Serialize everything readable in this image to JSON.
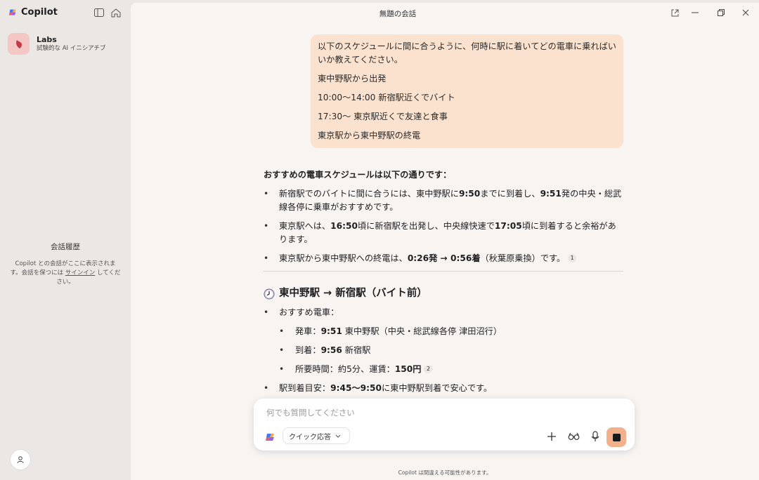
{
  "app": {
    "name": "Copilot"
  },
  "window": {
    "title": "無題の会話"
  },
  "sidebar": {
    "labs": {
      "title": "Labs",
      "subtitle": "試験的な AI イニシアチブ"
    },
    "history": {
      "title": "会話履歴",
      "text_before": "Copilot との会話がここに表示されます。会話を保つには ",
      "link": "サインイン",
      "text_after": " してください。"
    }
  },
  "user_message": {
    "paragraphs": [
      "以下のスケジュールに間に合うように、何時に駅に着いてどの電車に乗ればいいか教えてください。",
      "東中野駅から出発",
      "10:00〜14:00 新宿駅近くでバイト",
      "17:30〜 東京駅近くで友達と食事",
      "東京駅から東中野駅の終電"
    ]
  },
  "answer": {
    "intro": "おすすめの電車スケジュールは以下の通りです：",
    "summary": [
      {
        "parts": [
          {
            "t": "新宿駅でのバイトに間に合うには、東中野駅に",
            "b": false
          },
          {
            "t": "9:50",
            "b": true
          },
          {
            "t": "までに到着し、",
            "b": false
          },
          {
            "t": "9:51",
            "b": true
          },
          {
            "t": "発の中央・総武線各停に乗車がおすすめです。",
            "b": false
          }
        ]
      },
      {
        "parts": [
          {
            "t": "東京駅へは、",
            "b": false
          },
          {
            "t": "16:50",
            "b": true
          },
          {
            "t": "頃に新宿駅を出発し、中央線快速で",
            "b": false
          },
          {
            "t": "17:05",
            "b": true
          },
          {
            "t": "頃に到着すると余裕があります。",
            "b": false
          }
        ]
      },
      {
        "parts": [
          {
            "t": "東京駅から東中野駅への終電は、",
            "b": false
          },
          {
            "t": "0:26発 → 0:56着",
            "b": true
          },
          {
            "t": "（秋葉原乗換）です。",
            "b": false
          }
        ],
        "cite": "1"
      }
    ],
    "section": {
      "heading": "東中野駅 → 新宿駅（バイト前）",
      "recommend_label": "おすすめ電車：",
      "details": [
        {
          "parts": [
            {
              "t": "発車：",
              "b": false
            },
            {
              "t": "9:51",
              "b": true
            },
            {
              "t": " 東中野駅（中央・総武線各停 津田沼行）",
              "b": false
            }
          ]
        },
        {
          "parts": [
            {
              "t": "到着：",
              "b": false
            },
            {
              "t": "9:56",
              "b": true
            },
            {
              "t": " 新宿駅",
              "b": false
            }
          ]
        },
        {
          "parts": [
            {
              "t": "所要時間：約5分、運賃：",
              "b": false
            },
            {
              "t": "150円",
              "b": true
            }
          ],
          "cite": "2"
        }
      ],
      "arrival": {
        "parts": [
          {
            "t": "駅到着目安：",
            "b": false
          },
          {
            "t": "9:45〜9:50",
            "b": true
          },
          {
            "t": "に東中野駅到着で安心です。",
            "b": false
          }
        ]
      }
    }
  },
  "composer": {
    "placeholder": "何でも質問してください",
    "mode_label": "クイック応答"
  },
  "footer": {
    "note": "Copilot は間違える可能性があります。"
  }
}
